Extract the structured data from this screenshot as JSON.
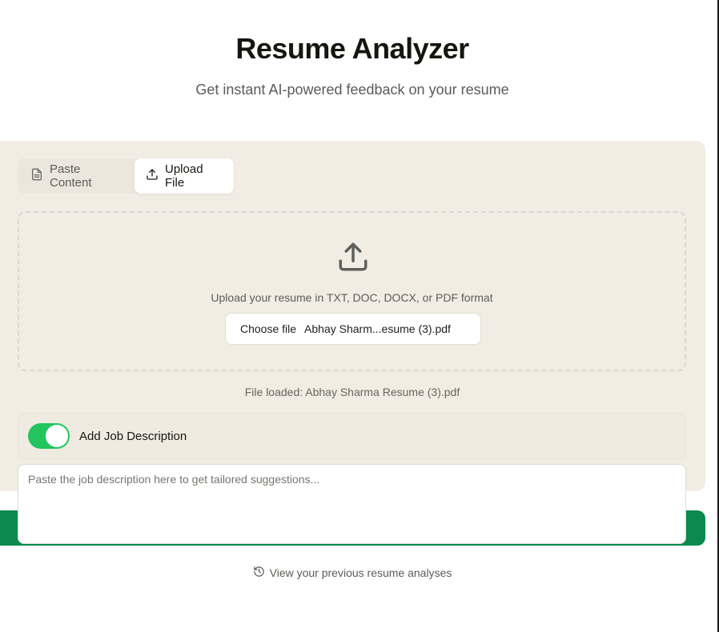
{
  "header": {
    "title": "Resume Analyzer",
    "subtitle": "Get instant AI-powered feedback on your resume"
  },
  "tabs": [
    {
      "label": "Paste Content",
      "icon": "file-text-icon",
      "active": false
    },
    {
      "label": "Upload File",
      "icon": "upload-icon",
      "active": true
    }
  ],
  "upload": {
    "icon": "upload-icon",
    "instructions": "Upload your resume in TXT, DOC, DOCX, or PDF format",
    "choose_label": "Choose file",
    "selected_file": "Abhay Sharm...esume (3).pdf",
    "loaded_message": "File loaded: Abhay Sharma Resume (3).pdf"
  },
  "job_description": {
    "toggle_label": "Add Job Description",
    "toggle_on": true,
    "placeholder": "Paste the job description here to get tailored suggestions...",
    "value": ""
  },
  "history": {
    "icon": "history-icon",
    "label": "View your previous resume analyses"
  },
  "colors": {
    "card_bg": "#f1ede2",
    "toggle_on": "#22c55e",
    "primary_button": "#0a8a4f"
  }
}
